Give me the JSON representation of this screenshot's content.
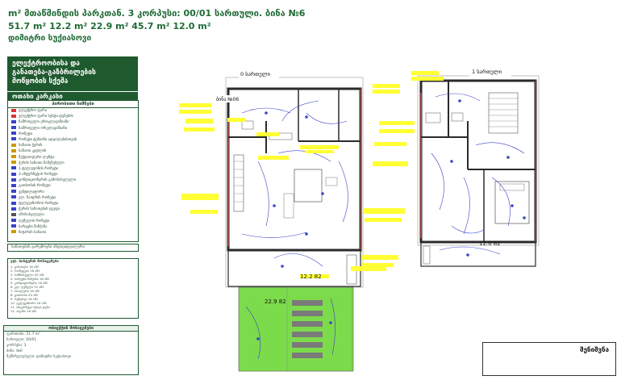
{
  "header": {
    "line1": "m² მთაწმინდის პარკთან. 3 კორპუსი: 00/01 სართული. ბინა №6",
    "line2": "51.7 m²  12.2 m²  22.9 m²  45.7 m²  12.0 m²",
    "line3": "დიმიტრი სუქიასოვი"
  },
  "title_box": {
    "line1": "ელექტროობისა და",
    "line2": "განათება-გაზბრილების",
    "line3": "მოწყობის სქემა"
  },
  "subtitle": "ოთახი კარკასი",
  "legend": {
    "heading": "პირობითი ნიშნები",
    "items": [
      "ელექტრო ფარი",
      "ელექტრო ფარი სუსტი დენების",
      "ჩამრთველი ერთკლავიშიანი",
      "ჩამრთველი ორკლავიშიანი",
      "როზეტი",
      "როზეტი ტენიანი ადგილებისთვის",
      "სანათი ჭერის",
      "სანათი კედლის",
      "შუქდიოდური ლენტა",
      "ჭერის სანათი ჩაშენებული",
      "1 ტელეფონის როზეტი",
      "2 ინტერნეტის როზეტი",
      "კონდიციონერის გამოსასვლელი",
      "გათბობის როზეტი",
      "ვენტილატორი",
      "ელ. ჩაიდნის როზეტი",
      "ტელევიზორის როზეტი",
      "ჭერის სანათების ჯგუფი",
      "ამოსასვლელი",
      "ღუმელის როზეტი",
      "სარეცხი მანქანა",
      "ნიჟარის სანათი"
    ],
    "footer": "სანათების გარემოები ინდივიდუალური"
  },
  "notes": {
    "heading": "ელ. სისტემის მონაცემები",
    "lines": [
      "1. განათება 16 ამპ",
      "2. როზეტები 16 ამპ",
      "3. სამზარეულო 20 ამპ",
      "4. სარეცხი მანქანა 16 ამპ",
      "5. კონდიციონერი 16 ამპ",
      "6. ელ. ღუმელი 32 ამპ",
      "7. ბოილერი 16 ამპ",
      "8. გათბობა 20 ამპ",
      "9. რეზერვი 16 ამპ",
      "10. ტელევიზორი 16 ამპ",
      "11. ინტერნეტი სუსტი დენი",
      "12. აივანი 16 ამპ"
    ]
  },
  "bottom_panel": {
    "heading": "ობიექტის მონაცემები",
    "lines": [
      "ფართობი: 51.7 m²",
      "სართული: 00/01",
      "კორპუსი: 3",
      "ბინა: №6",
      "შემსრულებელი: დიმიტრი სუქიასოვი"
    ]
  },
  "plans": {
    "left_title": "0 სართული",
    "right_title": "1 სართული",
    "apt_label": "ბინა №06",
    "area_terrace_left": "12.2 82",
    "area_garden": "22.9 82",
    "area_terrace_right": "12.0 82"
  },
  "stamp": {
    "label": "შენიშვნა"
  },
  "colors": {
    "wall": "#2a2a2a",
    "wire": "#3a43c8",
    "annotation": "#ffff33",
    "garden": "#7cdb4a",
    "brand": "#1f5a2f",
    "highlight_wall": "#e05a5a"
  }
}
